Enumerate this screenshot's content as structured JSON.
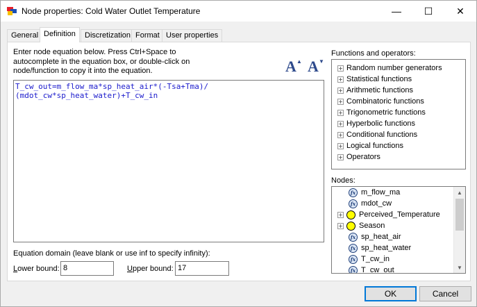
{
  "window": {
    "title": "Node properties: Cold Water Outlet Temperature",
    "controls": {
      "minimize": "—",
      "maximize": "☐",
      "close": "✕"
    }
  },
  "tabs": [
    {
      "label": "General"
    },
    {
      "label": "Definition",
      "active": true
    },
    {
      "label": "Discretization"
    },
    {
      "label": "Format"
    },
    {
      "label": "User properties"
    }
  ],
  "definition": {
    "instructions": "Enter node equation below. Press Ctrl+Space to autocomplete in the equation box, or double-click on node/function to copy it into the equation.",
    "font_button_glyph": "A",
    "font_increase_arrow": "▲",
    "font_decrease_arrow": "▼",
    "equation": "T_cw_out=m_flow_ma*sp_heat_air*(-Tsa+Tma)/\n(mdot_cw*sp_heat_water)+T_cw_in",
    "domain_label": "Equation domain (leave blank or use inf to specify infinity):",
    "lower_bound_label_accel": "L",
    "lower_bound_label_rest": "ower bound:",
    "lower_bound_value": "8",
    "upper_bound_label_accel": "U",
    "upper_bound_label_rest": "pper bound:",
    "upper_bound_value": "17"
  },
  "functions": {
    "label": "Functions and operators:",
    "expand_glyph": "+",
    "items": [
      "Random number generators",
      "Statistical functions",
      "Arithmetic functions",
      "Combinatoric functions",
      "Trigonometric functions",
      "Hyperbolic functions",
      "Conditional functions",
      "Logical functions",
      "Operators"
    ]
  },
  "nodes": {
    "label": "Nodes:",
    "expand_glyph": "+",
    "fx_glyph": "fx",
    "items": [
      {
        "label": "m_flow_ma",
        "icon": "function-node-icon",
        "expandable": false
      },
      {
        "label": "mdot_cw",
        "icon": "function-node-icon",
        "expandable": false
      },
      {
        "label": "Perceived_Temperature",
        "icon": "discrete-node-icon",
        "expandable": true
      },
      {
        "label": "Season",
        "icon": "discrete-node-icon",
        "expandable": true
      },
      {
        "label": "sp_heat_air",
        "icon": "function-node-icon",
        "expandable": false
      },
      {
        "label": "sp_heat_water",
        "icon": "function-node-icon",
        "expandable": false
      },
      {
        "label": "T_cw_in",
        "icon": "function-node-icon",
        "expandable": false
      },
      {
        "label": "T_cw_out",
        "icon": "function-node-icon",
        "expandable": false
      }
    ],
    "scroll_up_glyph": "▲",
    "scroll_down_glyph": "▼"
  },
  "buttons": {
    "ok": "OK",
    "cancel": "Cancel"
  },
  "colors": {
    "equation_text": "#1a1acc",
    "font_button": "#2e4a8c",
    "node_discrete": "#ffff00",
    "node_function": "#dbe6f5",
    "ok_border": "#0078d7"
  }
}
